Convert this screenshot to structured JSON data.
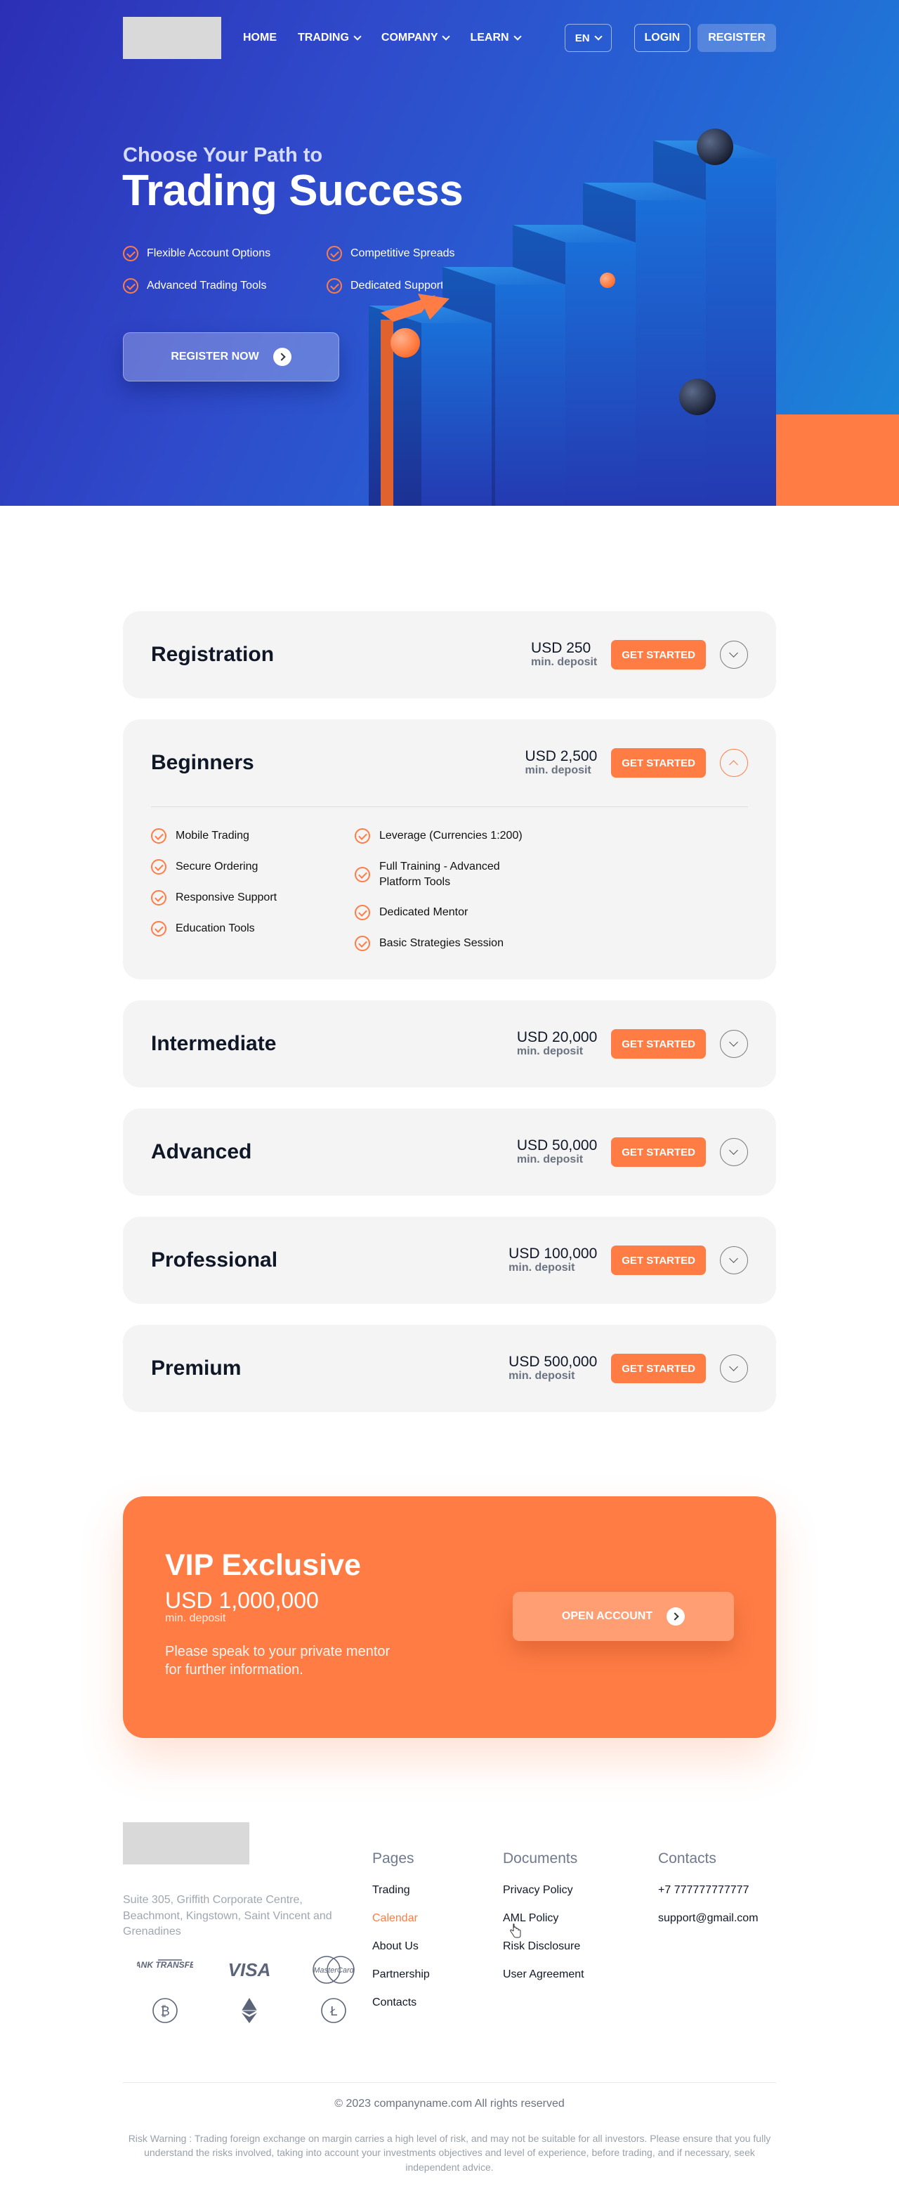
{
  "nav": {
    "links": [
      {
        "label": "HOME"
      },
      {
        "label": "TRADING"
      },
      {
        "label": "COMPANY"
      },
      {
        "label": "LEARN"
      }
    ],
    "lang": "EN",
    "login": "LOGIN",
    "register": "REGISTER"
  },
  "hero": {
    "subtitle": "Choose Your Path to",
    "title": "Trading Success",
    "features": [
      "Flexible Account Options",
      "Competitive Spreads",
      "Advanced Trading Tools",
      "Dedicated Support"
    ],
    "cta": "REGISTER NOW"
  },
  "plans": {
    "cta": "GET STARTED",
    "min_label": "min. deposit",
    "items": [
      {
        "name": "Registration",
        "amount": "USD 250"
      },
      {
        "name": "Beginners",
        "amount": "USD 2,500"
      },
      {
        "name": "Intermediate",
        "amount": "USD 20,000"
      },
      {
        "name": "Advanced",
        "amount": "USD 50,000"
      },
      {
        "name": "Professional",
        "amount": "USD 100,000"
      },
      {
        "name": "Premium",
        "amount": "USD 500,000"
      }
    ],
    "expanded_features": {
      "left": [
        "Mobile Trading",
        "Secure Ordering",
        "Responsive Support",
        "Education Tools"
      ],
      "right": [
        "Leverage (Currencies 1:200)",
        "Full Training - Advanced Platform Tools",
        "Dedicated Mentor",
        "Basic Strategies Session"
      ]
    }
  },
  "vip": {
    "title": "VIP Exclusive",
    "amount": "USD 1,000,000",
    "min": "min. deposit",
    "text": "Please speak to your private mentor for further information.",
    "cta": "OPEN ACCOUNT"
  },
  "footer": {
    "address": "Suite 305, Griffith Corporate Centre, Beachmont, Kingstown, Saint Vincent and Grenadines",
    "payments": {
      "bank": "BANK TRANSFER",
      "visa": "VISA",
      "mastercard": "MasterCard"
    },
    "pages": {
      "title": "Pages",
      "links": [
        "Trading",
        "Calendar",
        "About Us",
        "Partnership",
        "Contacts"
      ]
    },
    "documents": {
      "title": "Documents",
      "links": [
        "Privacy Policy",
        "AML Policy",
        "Risk Disclosure",
        "User Agreement"
      ]
    },
    "contacts": {
      "title": "Contacts",
      "phone": "+7 777777777777",
      "email": "support@gmail.com"
    },
    "copyright": "© 2023 companyname.com All rights reserved",
    "risk": "Risk Warning : Trading foreign exchange on margin carries a high level of risk, and may not be suitable for all investors. Please ensure that you fully understand the risks involved, taking into account your investments objectives and level of experience, before trading, and if necessary, seek independent advice."
  },
  "colors": {
    "accent": "#ff7c45",
    "hero_start": "#2c2fb6",
    "hero_end": "#1a8ad8",
    "card_bg": "#f4f4f5"
  }
}
